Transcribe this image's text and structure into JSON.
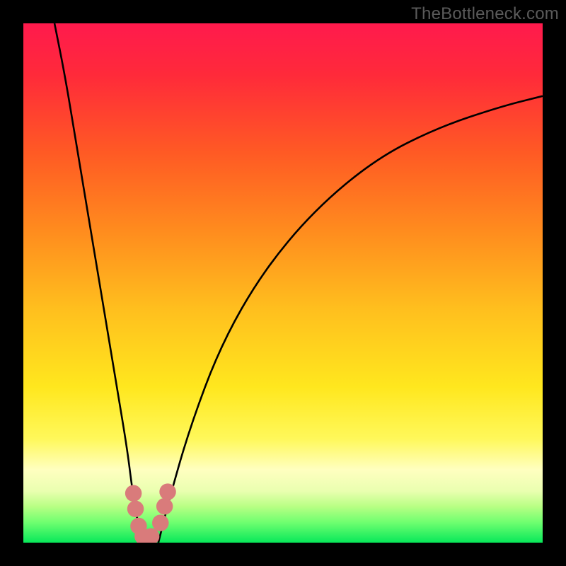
{
  "watermark": "TheBottleneck.com",
  "chart_data": {
    "type": "line",
    "title": "",
    "xlabel": "",
    "ylabel": "",
    "xlim": [
      0,
      100
    ],
    "ylim": [
      0,
      100
    ],
    "grid": false,
    "legend": false,
    "background": {
      "description": "vertical gradient red→orange→yellow→pale-yellow→green",
      "stops": [
        {
          "pos": 0.0,
          "color": "#ff1a4d"
        },
        {
          "pos": 0.1,
          "color": "#ff2a3a"
        },
        {
          "pos": 0.25,
          "color": "#ff5a24"
        },
        {
          "pos": 0.4,
          "color": "#ff8c1e"
        },
        {
          "pos": 0.55,
          "color": "#ffbf1e"
        },
        {
          "pos": 0.7,
          "color": "#ffe71e"
        },
        {
          "pos": 0.8,
          "color": "#fff85a"
        },
        {
          "pos": 0.86,
          "color": "#ffffc0"
        },
        {
          "pos": 0.9,
          "color": "#eaffb0"
        },
        {
          "pos": 0.93,
          "color": "#b8ff84"
        },
        {
          "pos": 0.96,
          "color": "#70ff70"
        },
        {
          "pos": 1.0,
          "color": "#08e85a"
        }
      ]
    },
    "series": [
      {
        "name": "left-branch",
        "stroke": "#000000",
        "x": [
          6,
          8,
          10,
          12,
          14,
          16,
          18,
          20,
          21,
          22,
          23
        ],
        "y": [
          100,
          90,
          78,
          66,
          54,
          42,
          30,
          18,
          10,
          4,
          0
        ]
      },
      {
        "name": "right-branch",
        "stroke": "#000000",
        "x": [
          26,
          28,
          32,
          38,
          46,
          56,
          68,
          80,
          92,
          100
        ],
        "y": [
          0,
          8,
          22,
          38,
          52,
          64,
          74,
          80,
          84,
          86
        ]
      }
    ],
    "markers": [
      {
        "name": "valley-left-top",
        "x": 21.2,
        "y": 9.5,
        "color": "#d97b7b",
        "r": 1.6
      },
      {
        "name": "valley-left-mid",
        "x": 21.6,
        "y": 6.5,
        "color": "#d97b7b",
        "r": 1.6
      },
      {
        "name": "valley-left-bot",
        "x": 22.2,
        "y": 3.2,
        "color": "#d97b7b",
        "r": 1.6
      },
      {
        "name": "valley-floor-1",
        "x": 23.0,
        "y": 1.2,
        "color": "#d97b7b",
        "r": 1.6
      },
      {
        "name": "valley-floor-2",
        "x": 24.6,
        "y": 1.2,
        "color": "#d97b7b",
        "r": 1.6
      },
      {
        "name": "valley-right-bot",
        "x": 26.4,
        "y": 3.8,
        "color": "#d97b7b",
        "r": 1.6
      },
      {
        "name": "valley-right-mid",
        "x": 27.2,
        "y": 7.0,
        "color": "#d97b7b",
        "r": 1.6
      },
      {
        "name": "valley-right-top",
        "x": 27.8,
        "y": 9.8,
        "color": "#d97b7b",
        "r": 1.6
      }
    ]
  }
}
